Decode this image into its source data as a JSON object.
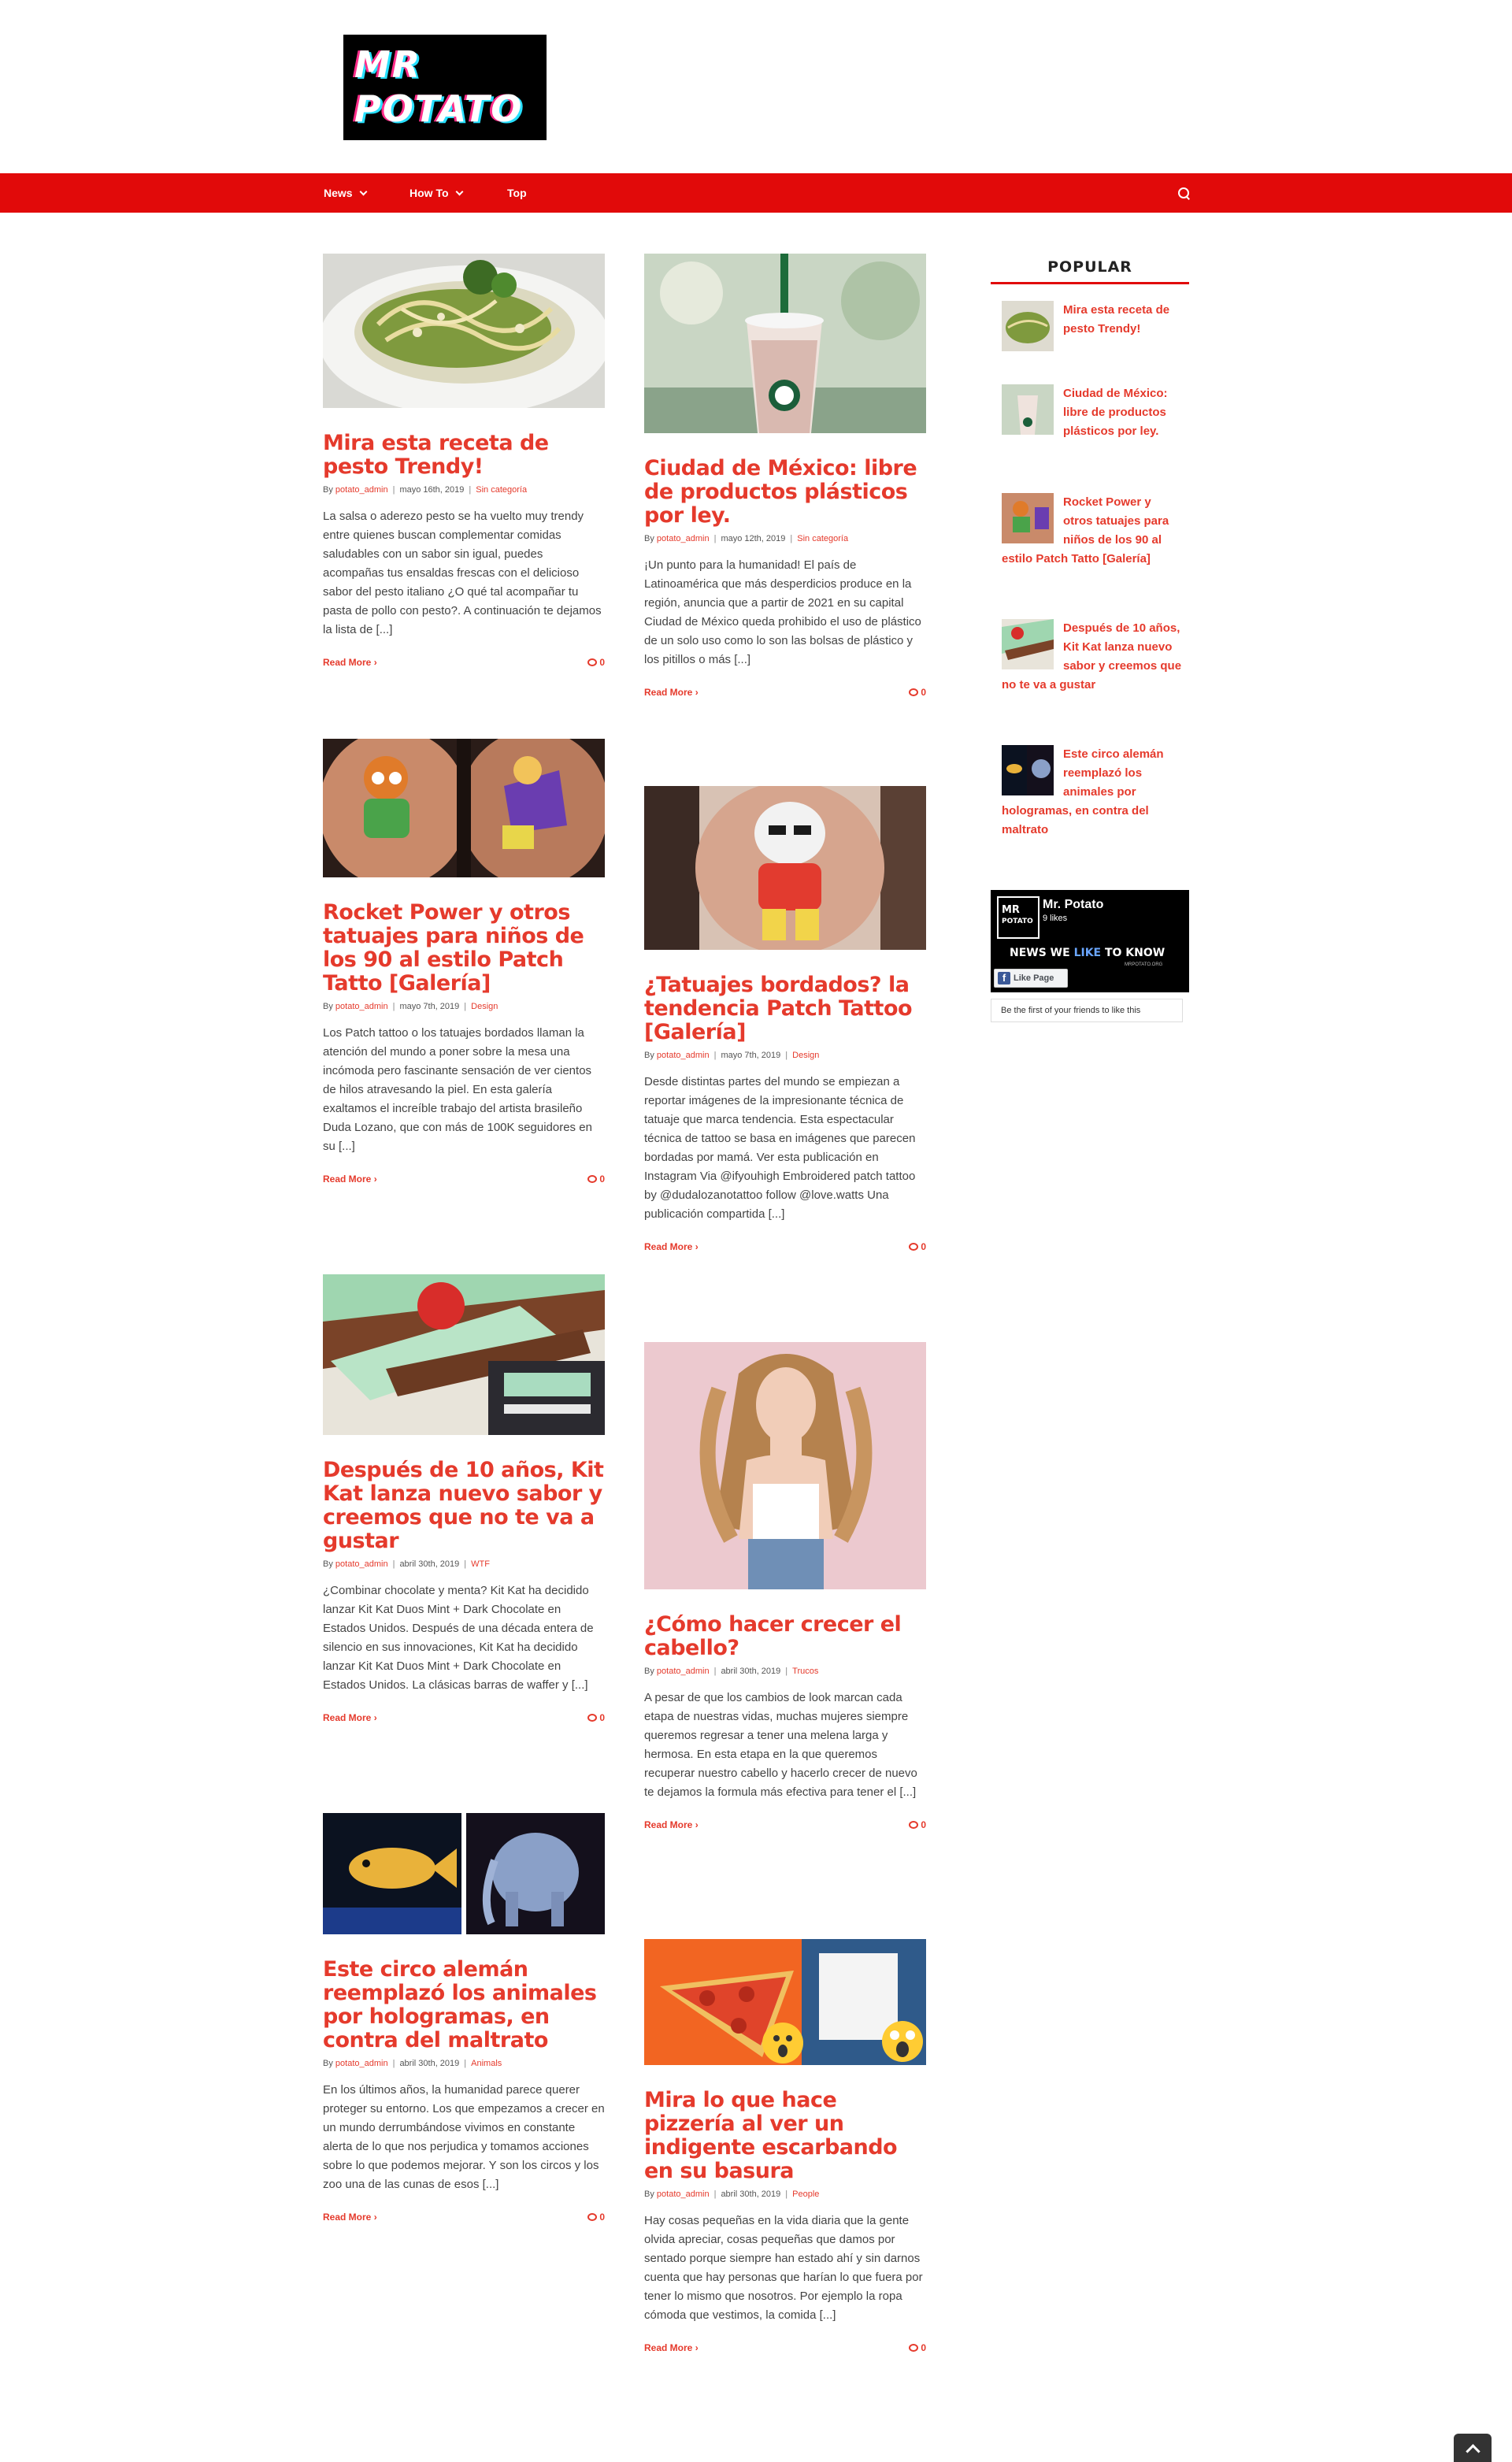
{
  "header": {
    "logo_line1": "MR",
    "logo_line2": "POTATO"
  },
  "nav": {
    "items": [
      {
        "label": "News",
        "dropdown": true
      },
      {
        "label": "How To",
        "dropdown": true
      },
      {
        "label": "Top",
        "dropdown": false
      }
    ],
    "search_icon": "search-icon"
  },
  "posts": [
    {
      "title": "Mira esta receta de pesto Trendy!",
      "author_prefix": "By",
      "author": "potato_admin",
      "date": "mayo 16th, 2019",
      "category": "Sin categoría",
      "excerpt": "La salsa o aderezo pesto se ha vuelto muy trendy entre quienes buscan complementar comidas saludables con un sabor sin igual, puedes acompañas tus ensaldas frescas con el delicioso sabor del pesto italiano ¿O qué tal acompañar tu pasta de pollo con pesto?. A continuación te dejamos la lista de [...]",
      "read_more": "Read More",
      "comments": "0"
    },
    {
      "title": "Ciudad de México: libre de productos plásticos por ley.",
      "author_prefix": "By",
      "author": "potato_admin",
      "date": "mayo 12th, 2019",
      "category": "Sin categoría",
      "excerpt": "¡Un punto para la humanidad! El país de Latinoamérica que más desperdicios produce en la región, anuncia que a partir de 2021 en su capital Ciudad de México queda prohibido el uso de plástico de un solo uso como lo son las bolsas de plástico y los pitillos o más [...]",
      "read_more": "Read More",
      "comments": "0"
    },
    {
      "title": "Rocket Power y otros tatuajes para niños de los 90 al estilo Patch Tatto [Galería]",
      "author_prefix": "By",
      "author": "potato_admin",
      "date": "mayo 7th, 2019",
      "category": "Design",
      "excerpt": "Los Patch tattoo o los tatuajes bordados llaman la atención del mundo a poner sobre la mesa una incómoda pero fascinante sensación de ver cientos de hilos atravesando la piel. En esta galería exaltamos el increíble trabajo del artista brasileño Duda Lozano, que con más de 100K seguidores en su [...]",
      "read_more": "Read More",
      "comments": "0"
    },
    {
      "title": "¿Tatuajes bordados? la tendencia Patch Tattoo [Galería]",
      "author_prefix": "By",
      "author": "potato_admin",
      "date": "mayo 7th, 2019",
      "category": "Design",
      "excerpt": "Desde distintas partes del mundo se empiezan a reportar imágenes de la impresionante técnica de tatuaje que marca tendencia. Esta espectacular técnica de tattoo se basa en imágenes que parecen bordadas por mamá. Ver esta publicación en Instagram Via @ifyouhigh Embroidered patch tattoo by @dudalozanotattoo follow @love.watts Una publicación compartida [...]",
      "read_more": "Read More",
      "comments": "0"
    },
    {
      "title": "Después de 10 años, Kit Kat lanza nuevo sabor y creemos que no te va a gustar",
      "author_prefix": "By",
      "author": "potato_admin",
      "date": "abril 30th, 2019",
      "category": "WTF",
      "excerpt": "¿Combinar chocolate y menta? Kit Kat ha decidido lanzar Kit Kat Duos Mint + Dark Chocolate en Estados Unidos. Después de una década entera de silencio en sus innovaciones, Kit Kat ha decidido lanzar Kit Kat Duos Mint + Dark Chocolate en Estados Unidos. La clásicas barras de waffer y [...]",
      "read_more": "Read More",
      "comments": "0"
    },
    {
      "title": "¿Cómo hacer crecer el cabello?",
      "author_prefix": "By",
      "author": "potato_admin",
      "date": "abril 30th, 2019",
      "category": "Trucos",
      "excerpt": "A pesar de que los cambios de look marcan cada etapa de nuestras vidas,  muchas mujeres siempre queremos regresar a tener una melena larga y hermosa. En esta etapa en la que queremos recuperar nuestro cabello y hacerlo crecer de nuevo te dejamos la formula más efectiva para tener el [...]",
      "read_more": "Read More",
      "comments": "0"
    },
    {
      "title": "Este circo alemán reemplazó los animales por hologramas, en contra del maltrato",
      "author_prefix": "By",
      "author": "potato_admin",
      "date": "abril 30th, 2019",
      "category": "Animals",
      "excerpt": "En los últimos años, la humanidad parece querer proteger su entorno. Los que empezamos a crecer en un mundo derrumbándose vivimos en constante alerta de lo que nos perjudica y tomamos acciones sobre lo que podemos mejorar. Y son los circos y los zoo una de las cunas de esos [...]",
      "read_more": "Read More",
      "comments": "0"
    },
    {
      "title": "Mira lo que hace pizzería al ver un indigente escarbando en su basura",
      "author_prefix": "By",
      "author": "potato_admin",
      "date": "abril 30th, 2019",
      "category": "People",
      "excerpt": "Hay cosas pequeñas en la vida diaria que la gente olvida apreciar, cosas pequeñas que damos por sentado porque siempre han estado ahí y sin darnos cuenta que hay personas que harían lo que fuera por tener lo mismo que nosotros. Por ejemplo la ropa cómoda que vestimos, la comida [...]",
      "read_more": "Read More",
      "comments": "0"
    }
  ],
  "sidebar": {
    "title": "POPULAR",
    "popular": [
      "Mira esta receta de pesto Trendy!",
      "Ciudad de México: libre de productos plásticos por ley.",
      "Rocket Power y otros tatuajes para niños de los 90 al estilo Patch Tatto [Galería]",
      "Después de 10 años, Kit Kat lanza nuevo sabor y creemos que no te va a gustar",
      "Este circo alemán reemplazó los animales por hologramas, en contra del maltrato"
    ],
    "facebook": {
      "logo_line1": "MR",
      "logo_line2": "POTATO",
      "page_name": "Mr. Potato",
      "likes": "9 likes",
      "slogan_a": "NEWS WE ",
      "slogan_b": "LIKE",
      "slogan_c": " TO KNOW",
      "domain": "MRPOTATO.ORG",
      "like_button": "Like Page",
      "friends_text": "Be the first of your friends to like this"
    }
  },
  "colors": {
    "brand_red": "#e10a0a",
    "title_red": "#e53a2c"
  }
}
